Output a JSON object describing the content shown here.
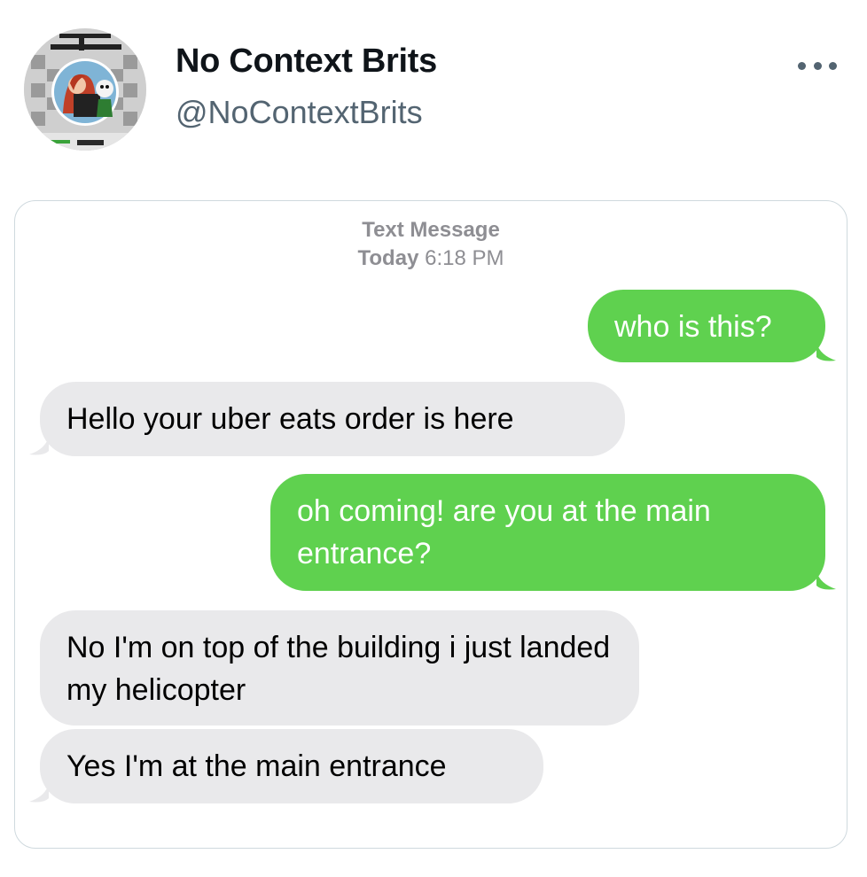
{
  "author": {
    "name": "No Context Brits",
    "handle": "@NoContextBrits"
  },
  "menu": {
    "icon": "more-horizontal-icon"
  },
  "message_header": {
    "title": "Text Message",
    "day": "Today",
    "time": "6:18 PM"
  },
  "messages": [
    {
      "side": "sent",
      "text": "who is this?"
    },
    {
      "side": "received",
      "text": "Hello your uber eats order is here"
    },
    {
      "side": "sent",
      "text": "oh coming! are you at the main entrance?"
    },
    {
      "side": "received",
      "text": "No I'm on top of the building i just landed my helicopter"
    },
    {
      "side": "received",
      "text": "Yes I'm at the main entrance"
    }
  ],
  "colors": {
    "sent_bubble": "#5fd14f",
    "received_bubble": "#e9e9eb",
    "meta_text": "#8e8e93",
    "handle_text": "#536471"
  }
}
